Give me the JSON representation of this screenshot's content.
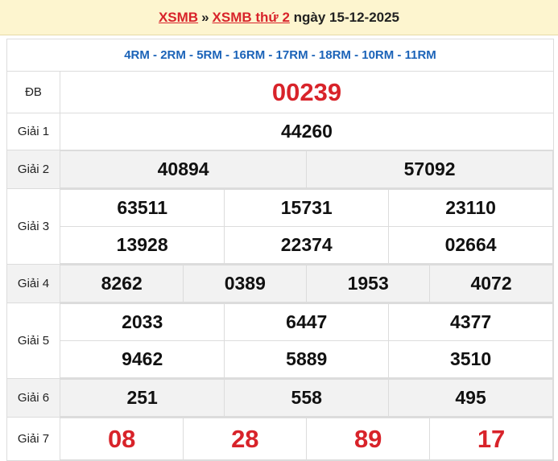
{
  "header": {
    "link1": "XSMB",
    "separator": "»",
    "link2": "XSMB thứ 2",
    "date_text": "ngày 15-12-2025"
  },
  "codes": "4RM - 2RM - 5RM - 16RM - 17RM - 18RM - 10RM - 11RM",
  "prizes": {
    "db": {
      "label": "ĐB",
      "values": [
        "00239"
      ]
    },
    "g1": {
      "label": "Giải 1",
      "values": [
        "44260"
      ]
    },
    "g2": {
      "label": "Giải 2",
      "values": [
        "40894",
        "57092"
      ]
    },
    "g3": {
      "label": "Giải 3",
      "values": [
        "63511",
        "15731",
        "23110",
        "13928",
        "22374",
        "02664"
      ]
    },
    "g4": {
      "label": "Giải 4",
      "values": [
        "8262",
        "0389",
        "1953",
        "4072"
      ]
    },
    "g5": {
      "label": "Giải 5",
      "values": [
        "2033",
        "6447",
        "4377",
        "9462",
        "5889",
        "3510"
      ]
    },
    "g6": {
      "label": "Giải 6",
      "values": [
        "251",
        "558",
        "495"
      ]
    },
    "g7": {
      "label": "Giải 7",
      "values": [
        "08",
        "28",
        "89",
        "17"
      ]
    }
  },
  "colors": {
    "header_bg": "#fdf5cf",
    "accent_red": "#d8232a",
    "code_blue": "#1b63b8",
    "row_shade": "#f2f2f2"
  }
}
